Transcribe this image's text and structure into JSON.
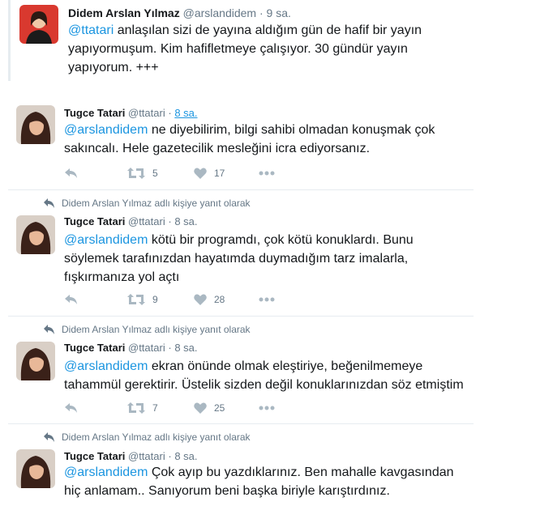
{
  "quoted": {
    "name": "Didem Arslan Yılmaz",
    "handle": "@arslandidem",
    "time": "9 sa.",
    "mention": "@ttatari",
    "text": " anlaşılan sizi de yayına aldığım gün de hafif bir yayın yapıyormuşum. Kim hafifletmeye çalışıyor. 30 gündür yayın yapıyorum. +++"
  },
  "reply_context": "Didem Arslan Yılmaz adlı kişiye yanıt olarak",
  "tweets": [
    {
      "name": "Tugce Tatari",
      "handle": "@ttatari",
      "time": "8 sa.",
      "mention": "@arslandidem",
      "text": " ne diyebilirim, bilgi sahibi olmadan konuşmak çok sakıncalı. Hele gazetecilik mesleğini icra ediyorsanız.",
      "retweets": "5",
      "likes": "17"
    },
    {
      "name": "Tugce Tatari",
      "handle": "@ttatari",
      "time": "8 sa.",
      "mention": "@arslandidem",
      "text": " kötü bir programdı, çok kötü konuklardı. Bunu söylemek tarafınızdan hayatımda duymadığım tarz imalarla, fışkırmanıza  yol açtı",
      "retweets": "9",
      "likes": "28"
    },
    {
      "name": "Tugce Tatari",
      "handle": "@ttatari",
      "time": "8 sa.",
      "mention": "@arslandidem",
      "text": " ekran önünde olmak eleştiriye, beğenilmemeye tahammül gerektirir. Üstelik sizden değil konuklarınızdan söz etmiştim",
      "retweets": "7",
      "likes": "25"
    },
    {
      "name": "Tugce Tatari",
      "handle": "@ttatari",
      "time": "8 sa.",
      "mention": "@arslandidem",
      "text": " Çok ayıp bu yazdıklarınız. Ben mahalle kavgasından hiç anlamam.. Sanıyorum beni başka biriyle karıştırdınız."
    }
  ],
  "colors": {
    "link": "#1b95e0",
    "secondary": "#657786",
    "icon": "#aab8c2",
    "divider": "#e6ecf0"
  },
  "icons": [
    "reply-icon",
    "retweet-icon",
    "like-icon",
    "more-icon",
    "reply-context-icon"
  ]
}
